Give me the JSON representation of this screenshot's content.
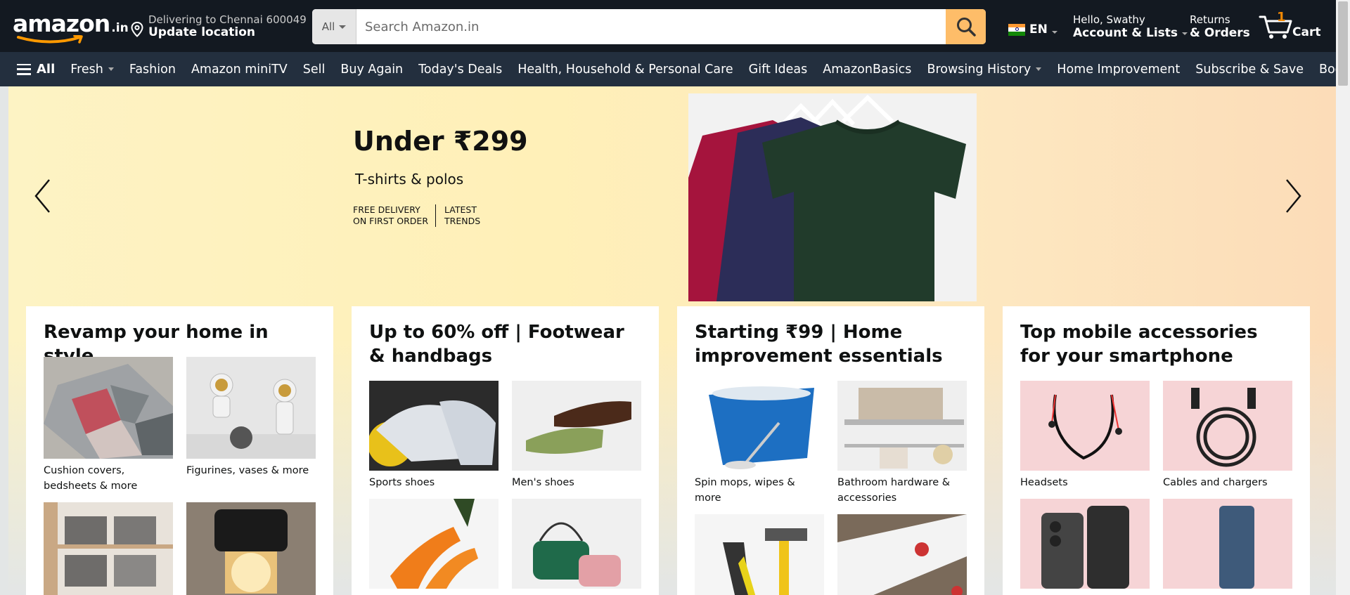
{
  "header": {
    "logo_text": "amazon",
    "logo_tld": ".in",
    "deliver_line1": "Delivering to Chennai 600049",
    "deliver_line2": "Update location",
    "search_category": "All",
    "search_placeholder": "Search Amazon.in",
    "language": "EN",
    "account_line1": "Hello, Swathy",
    "account_line2": "Account & Lists",
    "orders_line1": "Returns",
    "orders_line2": "& Orders",
    "cart_count": "1",
    "cart_label": "Cart"
  },
  "nav": {
    "all_label": "All",
    "items": [
      {
        "label": "Fresh",
        "dropdown": true
      },
      {
        "label": "Fashion"
      },
      {
        "label": "Amazon miniTV"
      },
      {
        "label": "Sell"
      },
      {
        "label": "Buy Again"
      },
      {
        "label": "Today's Deals"
      },
      {
        "label": "Health, Household & Personal Care"
      },
      {
        "label": "Gift Ideas"
      },
      {
        "label": "AmazonBasics"
      },
      {
        "label": "Browsing History",
        "dropdown": true
      },
      {
        "label": "Home Improvement"
      },
      {
        "label": "Subscribe & Save"
      },
      {
        "label": "Books"
      }
    ]
  },
  "hero": {
    "title": "Under ₹299",
    "subtitle": "T-shirts & polos",
    "tag1_line1": "FREE DELIVERY",
    "tag1_line2": "ON FIRST ORDER",
    "tag2_line1": "LATEST",
    "tag2_line2": "TRENDS"
  },
  "cards": [
    {
      "title": "Revamp your home in style",
      "items": [
        {
          "caption": "Cushion covers, bedsheets & more"
        },
        {
          "caption": "Figurines, vases & more"
        },
        {
          "caption": ""
        },
        {
          "caption": ""
        }
      ]
    },
    {
      "title": "Up to 60% off | Footwear & handbags",
      "items": [
        {
          "caption": "Sports shoes"
        },
        {
          "caption": "Men's shoes"
        },
        {
          "caption": ""
        },
        {
          "caption": ""
        }
      ]
    },
    {
      "title": "Starting ₹99 | Home improvement essentials",
      "items": [
        {
          "caption": "Spin mops, wipes & more"
        },
        {
          "caption": "Bathroom hardware & accessories"
        },
        {
          "caption": ""
        },
        {
          "caption": ""
        }
      ]
    },
    {
      "title": "Top mobile accessories for your smartphone",
      "items": [
        {
          "caption": "Headsets"
        },
        {
          "caption": "Cables and chargers"
        },
        {
          "caption": ""
        },
        {
          "caption": ""
        }
      ]
    }
  ]
}
